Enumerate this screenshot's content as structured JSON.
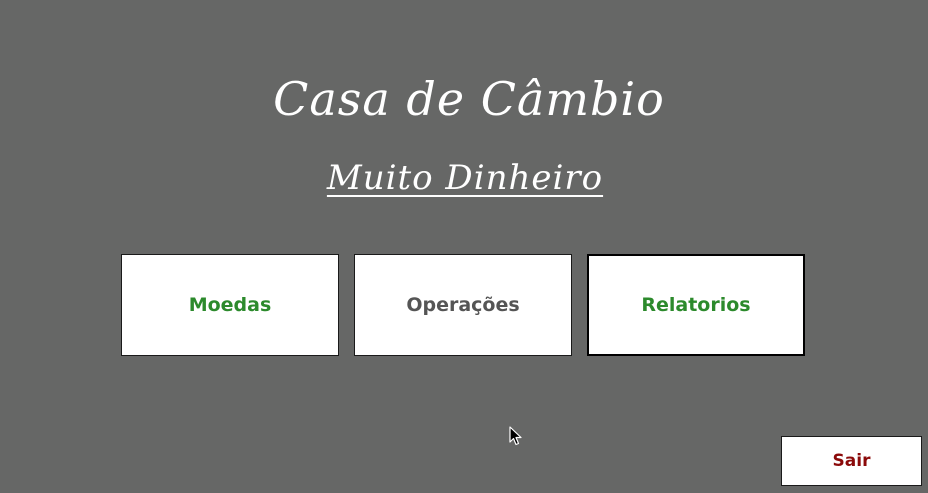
{
  "title": "Casa de Câmbio",
  "subtitle": "Muito Dinheiro",
  "buttons": {
    "moedas": "Moedas",
    "operacoes": "Operações",
    "relatorios": "Relatorios",
    "sair": "Sair"
  },
  "colors": {
    "background": "#666766",
    "green": "#2c8a2c",
    "gray": "#555555",
    "dark_red": "#8b0a0a"
  },
  "icons": {
    "cursor": "mouse-pointer-icon"
  }
}
